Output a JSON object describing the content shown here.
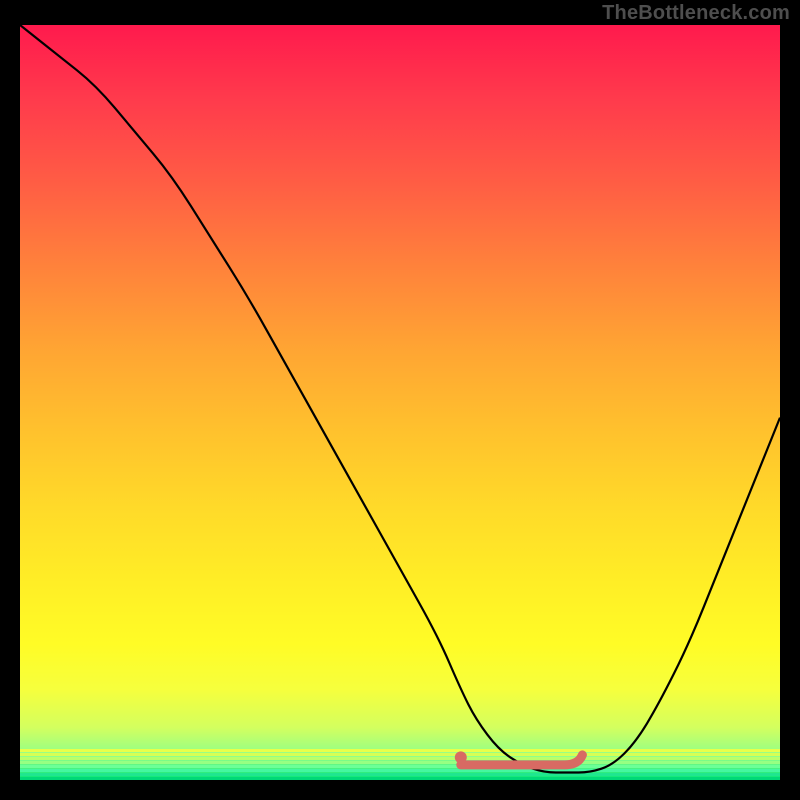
{
  "watermark": "TheBottleneck.com",
  "colors": {
    "frame": "#000000",
    "curve": "#000000",
    "marker": "#d86a63",
    "gradient_stops": [
      "#ff1a4d",
      "#ff3b4c",
      "#ff5a45",
      "#ff823b",
      "#ffa533",
      "#ffc22d",
      "#ffda29",
      "#ffee26",
      "#fffc26",
      "#f6ff3d",
      "#d4ff5e",
      "#8cff8c",
      "#00e676"
    ]
  },
  "chart_data": {
    "type": "line",
    "title": "",
    "xlabel": "",
    "ylabel": "",
    "xlim": [
      0,
      100
    ],
    "ylim": [
      0,
      100
    ],
    "series": [
      {
        "name": "bottleneck-curve",
        "x": [
          0,
          5,
          10,
          15,
          20,
          25,
          30,
          35,
          40,
          45,
          50,
          55,
          58,
          60,
          63,
          66,
          69,
          72,
          75,
          78,
          81,
          84,
          88,
          92,
          96,
          100
        ],
        "y": [
          100,
          96,
          92,
          86,
          80,
          72,
          64,
          55,
          46,
          37,
          28,
          19,
          12,
          8,
          4,
          2,
          1,
          1,
          1,
          2,
          5,
          10,
          18,
          28,
          38,
          48
        ]
      }
    ],
    "optimal_band": {
      "name": "optimal-range",
      "x_start": 58,
      "x_end": 74,
      "y": 2
    },
    "optimal_point": {
      "x": 58,
      "y": 3
    }
  }
}
